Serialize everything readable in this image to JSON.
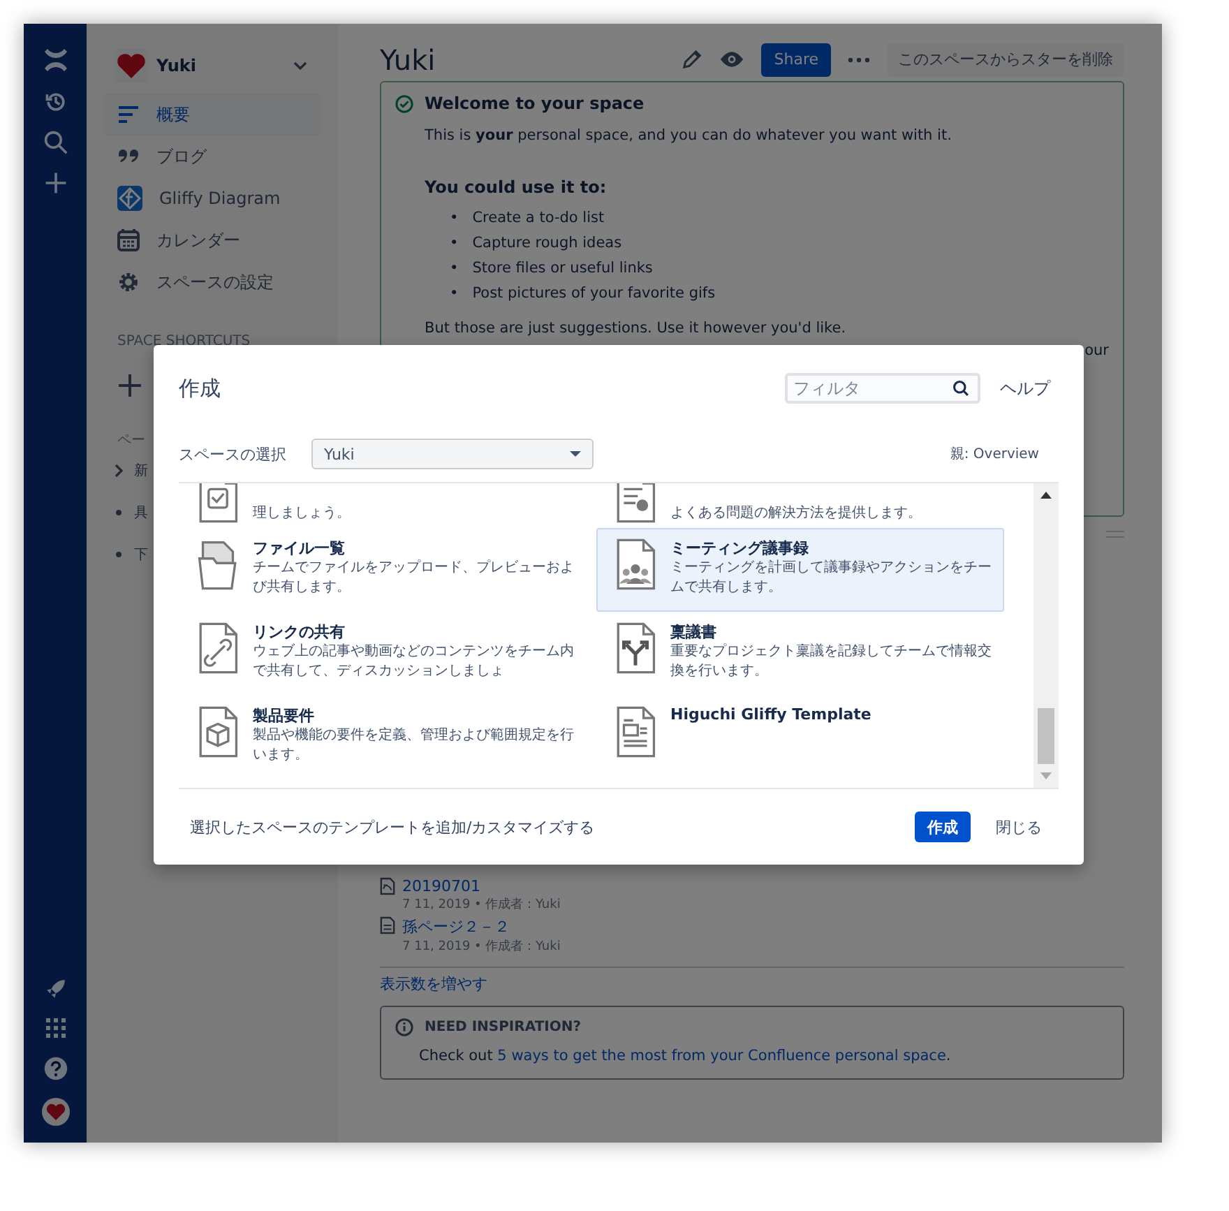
{
  "sidebar": {
    "space_name": "Yuki",
    "items": [
      {
        "kind": "overview",
        "label": "概要",
        "selected": true
      },
      {
        "kind": "blog",
        "label": "ブログ",
        "selected": false
      },
      {
        "kind": "gliffy",
        "label": "Gliffy Diagram",
        "selected": false
      },
      {
        "kind": "calendar",
        "label": "カレンダー",
        "selected": false
      },
      {
        "kind": "settings",
        "label": "スペースの設定",
        "selected": false
      }
    ],
    "shortcuts_heading": "SPACE SHORTCUTS",
    "pages_heading": "ペー",
    "page_tree": [
      {
        "label": "新",
        "has_children": true
      },
      {
        "label": "具",
        "has_children": false
      },
      {
        "label": "下",
        "has_children": false
      }
    ]
  },
  "main": {
    "title": "Yuki",
    "share_button": "Share",
    "unstar_button": "このスペースからスターを削除",
    "welcome": {
      "heading": "Welcome to your space",
      "intro": "This is **your** personal space, and you can do whatever you want with it.",
      "subheading": "You could use it to:",
      "bullet": "•",
      "bullets": [
        "Create a to-do list",
        "Capture rough ideas",
        "Store files or useful links",
        "Post pictures of your favorite gifs"
      ],
      "closing": "But those are just suggestions. Use it however you'd like.",
      "fragment": "our"
    },
    "recent": [
      {
        "kind": "blog",
        "title": "20190701",
        "meta": "7 11, 2019 • 作成者 : Yuki"
      },
      {
        "kind": "page",
        "title": "孫ページ２－２",
        "meta": "7 11, 2019 • 作成者 : Yuki"
      }
    ],
    "more_link": "表示数を増やす",
    "inspiration": {
      "heading": "NEED INSPIRATION?",
      "text_before": "Check out",
      "link": "5 ways to get the most from your Confluence personal space",
      "text_after": "."
    }
  },
  "dialog": {
    "title": "作成",
    "filter": {
      "placeholder": "フィルタ"
    },
    "help_link": "ヘルプ",
    "space_label": "スペースの選択",
    "space_select": "Yuki",
    "parent": "親: Overview",
    "templates": [
      {
        "kind": "tasks",
        "partial": true,
        "description": "理しましょう。",
        "selected": false
      },
      {
        "kind": "troubleshoot",
        "partial": true,
        "description": "よくある問題の解決方法を提供します。",
        "selected": false
      },
      {
        "kind": "files",
        "partial": false,
        "title": "ファイル一覧",
        "description": "チームでファイルをアップロード、プレビューおよび共有します。",
        "selected": false
      },
      {
        "kind": "meeting",
        "partial": false,
        "title": "ミーティング議事録",
        "description": "ミーティングを計画して議事録やアクションをチームで共有します。",
        "selected": true
      },
      {
        "kind": "link",
        "partial": false,
        "title": "リンクの共有",
        "description": "ウェブ上の記事や動画などのコンテンツをチーム内で共有して、ディスカッションしましょ",
        "selected": false
      },
      {
        "kind": "decision",
        "partial": false,
        "title": "稟議書",
        "description": "重要なプロジェクト稟議を記録してチームで情報交換を行います。",
        "selected": false
      },
      {
        "kind": "requirements",
        "partial": false,
        "title": "製品要件",
        "description": "製品や機能の要件を定義、管理および範囲規定を行います。",
        "selected": false
      },
      {
        "kind": "gliffy",
        "partial": false,
        "title": "Higuchi Gliffy Template",
        "selected": false
      }
    ],
    "customize_link": "選択したスペースのテンプレートを追加/カスタマイズする",
    "create_button": "作成",
    "close_button": "閉じる"
  }
}
